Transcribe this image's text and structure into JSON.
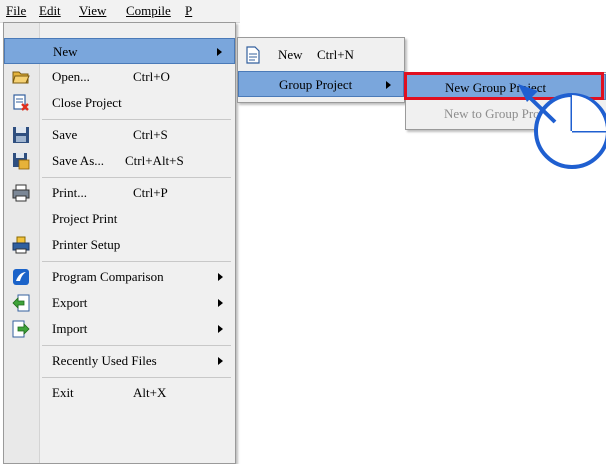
{
  "menubar": {
    "file": "File",
    "edit": "Edit",
    "view": "View",
    "compile": "Compile",
    "partial": "P"
  },
  "file_menu": {
    "new": "New",
    "open": "Open...",
    "open_shortcut": "Ctrl+O",
    "close_project": "Close Project",
    "save": "Save",
    "save_shortcut": "Ctrl+S",
    "save_as": "Save As...",
    "save_as_shortcut": "Ctrl+Alt+S",
    "print": "Print...",
    "print_shortcut": "Ctrl+P",
    "project_print": "Project Print",
    "printer_setup": "Printer Setup",
    "program_comparison": "Program Comparison",
    "export": "Export",
    "import": "Import",
    "recently_used": "Recently Used Files",
    "exit": "Exit",
    "exit_shortcut": "Alt+X"
  },
  "new_submenu": {
    "new": "New",
    "new_shortcut": "Ctrl+N",
    "group_project": "Group Project"
  },
  "group_submenu": {
    "new_group_project": "New Group Project",
    "new_to_group_project": "New to Group Pro"
  },
  "colors": {
    "highlight": "#7aa6dc",
    "callout_red": "#e01020",
    "pointer_blue": "#1f5fd0"
  }
}
